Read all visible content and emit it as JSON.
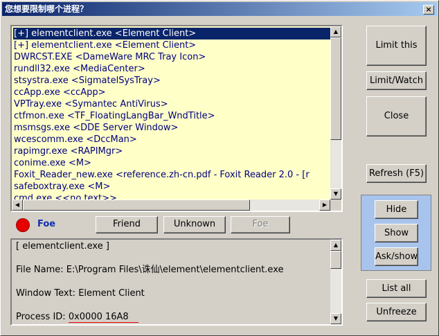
{
  "window": {
    "title": "您想要限制哪个进程？",
    "close_glyph": "×"
  },
  "process_list": [
    "[+] elementclient.exe <Element Client>",
    "[+] elementclient.exe <Element Client>",
    "DWRCST.EXE <DameWare MRC Tray Icon>",
    "rundll32.exe <MediaCenter>",
    "stsystra.exe <SigmatelSysTray>",
    "ccApp.exe <ccApp>",
    "VPTray.exe <Symantec AntiVirus>",
    "ctfmon.exe <TF_FloatingLangBar_WndTitle>",
    "msmsgs.exe <DDE Server Window>",
    "wcescomm.exe <DccMan>",
    "rapimgr.exe <RAPIMgr>",
    "conime.exe <M>",
    "Foxit_Reader_new.exe <reference.zh-cn.pdf - Foxit Reader 2.0 - [r",
    "safeboxtray.exe <M>",
    "cmd.exe <<no text>>"
  ],
  "selected_index": 0,
  "status": {
    "label": "Foe",
    "color": "#e60000"
  },
  "buttons": {
    "friend": "Friend",
    "unknown": "Unknown",
    "foe": "Foe",
    "limit_this": "Limit this",
    "limit_watch": "Limit/Watch",
    "close": "Close",
    "refresh": "Refresh (F5)",
    "hide": "Hide",
    "show": "Show",
    "ask_show": "Ask/show",
    "list_all": "List all",
    "unfreeze": "Unfreeze"
  },
  "info": {
    "header": "[ elementclient.exe ]",
    "file_name": "File Name: E:\\Program Files\\诛仙\\element\\elementclient.exe",
    "window_text": "Window Text: Element Client",
    "process_id_label": "Process ID: ",
    "process_id_value": "0x0000 16A8"
  }
}
